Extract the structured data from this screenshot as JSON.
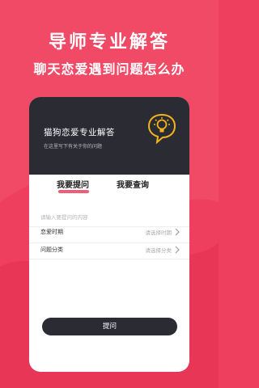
{
  "hero": {
    "title": "导师专业解答",
    "subtitle": "聊天恋爱遇到问题怎么办"
  },
  "card": {
    "title": "猫狗恋爱专业解答",
    "description": "在这里写下有关于你的问题",
    "icon": "lightbulb-chat-icon"
  },
  "tabs": [
    {
      "label": "我要提问",
      "active": true
    },
    {
      "label": "我要查询",
      "active": false
    }
  ],
  "form": {
    "question_placeholder": "请输入要提问的内容",
    "period_label": "恋爱时期",
    "period_value": "请选择时期",
    "category_label": "问题分类",
    "category_value": "请选择分类",
    "submit_label": "提问"
  },
  "colors": {
    "background": "#ef3f5e",
    "card_header": "#2b2b33",
    "accent": "#f3b51b"
  }
}
